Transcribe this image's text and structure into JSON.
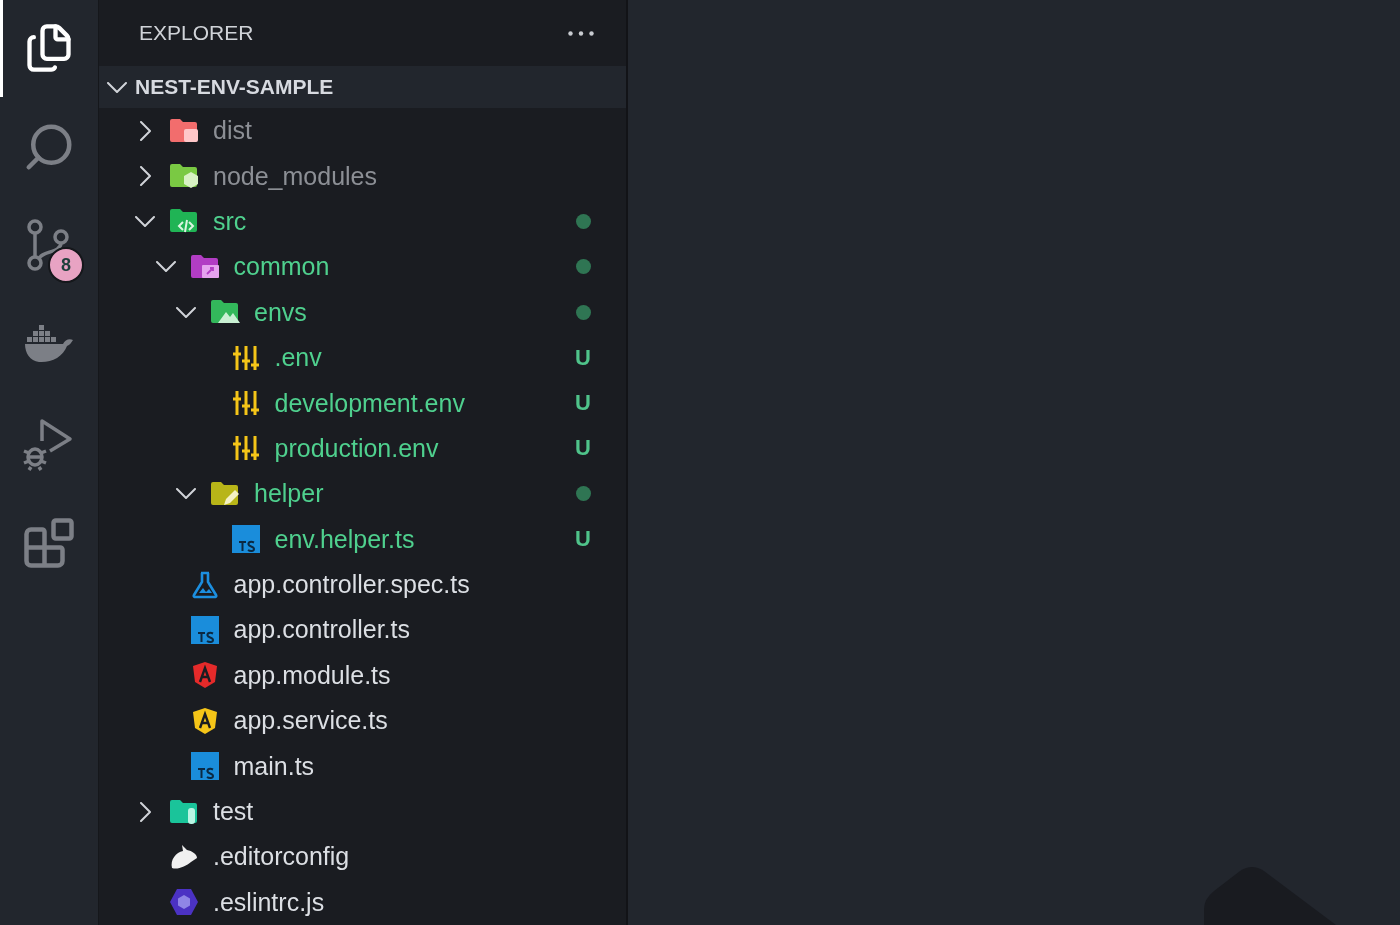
{
  "activity_bar": [
    {
      "kind": "files",
      "selected": true
    },
    {
      "kind": "search",
      "selected": false
    },
    {
      "kind": "source-control",
      "selected": false,
      "badge": "8"
    },
    {
      "kind": "docker",
      "selected": false
    },
    {
      "kind": "run-debug",
      "selected": false
    },
    {
      "kind": "extensions",
      "selected": false
    }
  ],
  "sidebar": {
    "title": "EXPLORER",
    "section": {
      "title": "NEST-ENV-SAMPLE",
      "expanded": true
    },
    "tree": [
      {
        "name": "dist",
        "kind": "dist-folder",
        "expanded": false,
        "ignored": true,
        "untracked": false
      },
      {
        "name": "node_modules",
        "kind": "node-folder",
        "expanded": false,
        "ignored": true,
        "untracked": false
      },
      {
        "name": "src",
        "kind": "src-folder",
        "expanded": true,
        "ignored": false,
        "untracked": true,
        "dot": true,
        "children": [
          {
            "name": "common",
            "kind": "common-folder",
            "expanded": true,
            "ignored": false,
            "untracked": true,
            "dot": true,
            "children": [
              {
                "name": "envs",
                "kind": "env-folder",
                "expanded": true,
                "ignored": false,
                "untracked": true,
                "dot": true,
                "children": [
                  {
                    "name": ".env",
                    "kind": "env-file",
                    "ignored": false,
                    "untracked": true,
                    "badge": "U"
                  },
                  {
                    "name": "development.env",
                    "kind": "env-file",
                    "ignored": false,
                    "untracked": true,
                    "badge": "U"
                  },
                  {
                    "name": "production.env",
                    "kind": "env-file",
                    "ignored": false,
                    "untracked": true,
                    "badge": "U"
                  }
                ]
              },
              {
                "name": "helper",
                "kind": "helper-folder",
                "expanded": true,
                "ignored": false,
                "untracked": true,
                "dot": true,
                "children": [
                  {
                    "name": "env.helper.ts",
                    "kind": "ts-file",
                    "ignored": false,
                    "untracked": true,
                    "badge": "U"
                  }
                ]
              }
            ]
          },
          {
            "name": "app.controller.spec.ts",
            "kind": "spec-file",
            "ignored": false,
            "untracked": false
          },
          {
            "name": "app.controller.ts",
            "kind": "ts-file",
            "ignored": false,
            "untracked": false
          },
          {
            "name": "app.module.ts",
            "kind": "module-file",
            "ignored": false,
            "untracked": false
          },
          {
            "name": "app.service.ts",
            "kind": "service-file",
            "ignored": false,
            "untracked": false
          },
          {
            "name": "main.ts",
            "kind": "ts-file",
            "ignored": false,
            "untracked": false
          }
        ]
      },
      {
        "name": "test",
        "kind": "test-folder",
        "expanded": false,
        "ignored": false,
        "untracked": false
      },
      {
        "name": ".editorconfig",
        "kind": "editorconfig-file",
        "ignored": false,
        "untracked": false
      },
      {
        "name": ".eslintrc.js",
        "kind": "eslint-file",
        "ignored": false,
        "untracked": false
      }
    ]
  }
}
